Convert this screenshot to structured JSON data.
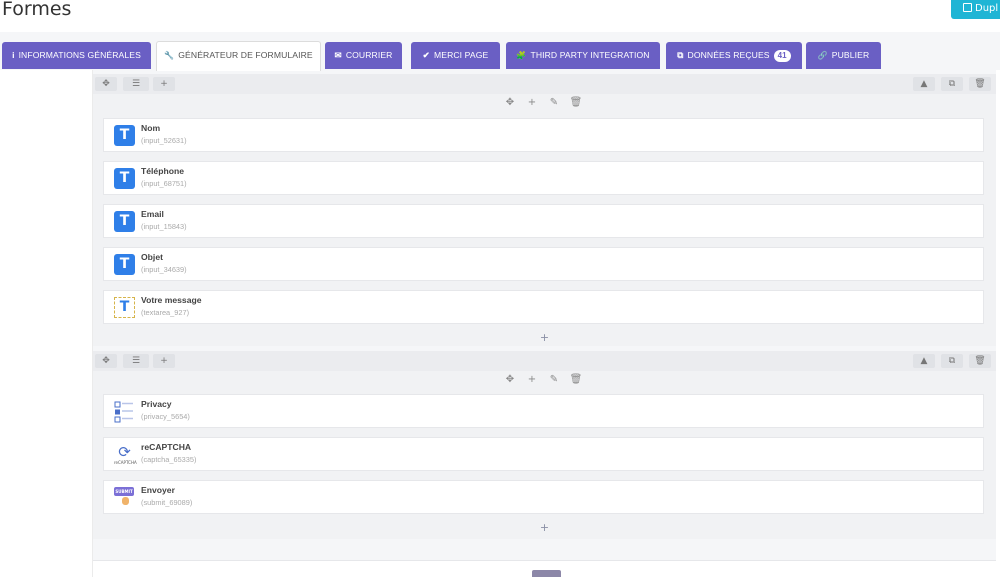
{
  "page": {
    "title": "Formes",
    "duplicate_label": "Dupl"
  },
  "tabs": [
    {
      "icon": "i",
      "label": "INFORMATIONS GÉNÉRALES"
    },
    {
      "icon": "🔧",
      "label": "GÉNÉRATEUR DE FORMULAIRE"
    },
    {
      "icon": "✉",
      "label": "COURRIER"
    },
    {
      "icon": "✔",
      "label": "MERCI PAGE"
    },
    {
      "icon": "🧩",
      "label": "THIRD PARTY INTEGRATION"
    },
    {
      "icon": "⧉",
      "label": "DONNÉES REÇUES",
      "badge": "41"
    },
    {
      "icon": "🔗",
      "label": "PUBLIER"
    }
  ],
  "section1": {
    "fields": [
      {
        "icon": "text-field-icon",
        "glyph": "T",
        "label": "Nom",
        "id": "(input_52631)"
      },
      {
        "icon": "text-field-icon",
        "glyph": "T",
        "label": "Téléphone",
        "id": "(input_68751)"
      },
      {
        "icon": "text-field-icon",
        "glyph": "T",
        "label": "Email",
        "id": "(input_15843)"
      },
      {
        "icon": "text-field-icon",
        "glyph": "T",
        "label": "Objet",
        "id": "(input_34639)"
      },
      {
        "icon": "textarea-icon",
        "glyph": "T",
        "label": "Votre message",
        "id": "(textarea_927)"
      }
    ]
  },
  "section2": {
    "fields": [
      {
        "icon": "privacy-checkbox-icon",
        "label": "Privacy",
        "id": "(privacy_5654)"
      },
      {
        "icon": "recaptcha-icon",
        "label": "reCAPTCHA",
        "id": "(captcha_65335)",
        "icon_text": "reCAPTCHA"
      },
      {
        "icon": "submit-button-icon",
        "label": "Envoyer",
        "id": "(submit_69089)",
        "icon_text": "SUBMIT"
      }
    ]
  },
  "colors": {
    "tab": "#6a5fc4",
    "accent": "#1fb5d5",
    "field_icon": "#2f7fe8"
  }
}
